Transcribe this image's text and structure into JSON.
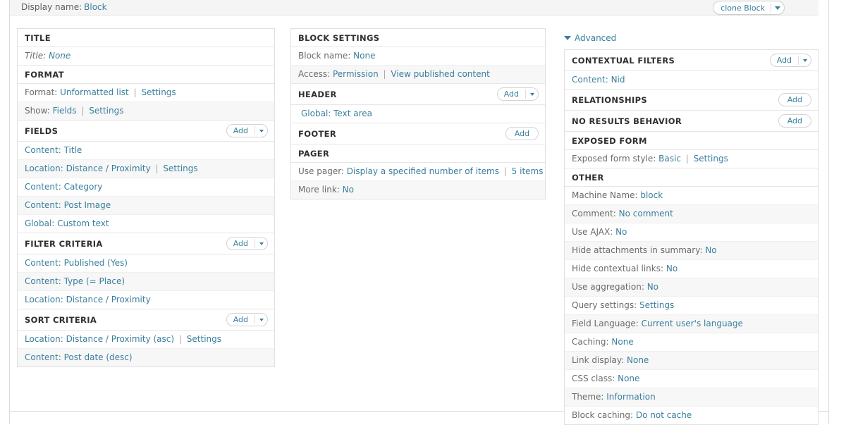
{
  "display_bar": {
    "label": "Display name:",
    "value": "Block",
    "clone_button": {
      "label": "clone Block",
      "caret_icon": "chevron-down-icon"
    }
  },
  "buttons": {
    "add": "Add"
  },
  "left_column": {
    "sections": [
      {
        "title": "TITLE",
        "has_add": false,
        "rows": [
          {
            "label": "Title:",
            "parts": [
              {
                "text": "None",
                "type": "link"
              }
            ],
            "italic": true
          }
        ]
      },
      {
        "title": "FORMAT",
        "has_add": false,
        "rows": [
          {
            "label": "Format:",
            "parts": [
              {
                "text": "Unformatted list",
                "type": "link"
              },
              {
                "text": "|",
                "type": "sep"
              },
              {
                "text": "Settings",
                "type": "link"
              }
            ]
          },
          {
            "label": "Show:",
            "parts": [
              {
                "text": "Fields",
                "type": "link"
              },
              {
                "text": "|",
                "type": "sep"
              },
              {
                "text": "Settings",
                "type": "link"
              }
            ]
          }
        ]
      },
      {
        "title": "FIELDS",
        "has_add": true,
        "add_caret": true,
        "rows": [
          {
            "label": "",
            "parts": [
              {
                "text": "Content: Title",
                "type": "link"
              }
            ]
          },
          {
            "label": "",
            "parts": [
              {
                "text": "Location: Distance / Proximity",
                "type": "link"
              },
              {
                "text": "|",
                "type": "sep"
              },
              {
                "text": "Settings",
                "type": "link"
              }
            ]
          },
          {
            "label": "",
            "parts": [
              {
                "text": "Content: Category",
                "type": "link"
              }
            ]
          },
          {
            "label": "",
            "parts": [
              {
                "text": "Content: Post Image",
                "type": "link"
              }
            ]
          },
          {
            "label": "",
            "parts": [
              {
                "text": "Global: Custom text",
                "type": "link"
              }
            ]
          }
        ]
      },
      {
        "title": "FILTER CRITERIA",
        "has_add": true,
        "add_caret": true,
        "rows": [
          {
            "label": "",
            "parts": [
              {
                "text": "Content: Published (Yes)",
                "type": "link"
              }
            ]
          },
          {
            "label": "",
            "parts": [
              {
                "text": "Content: Type (= Place)",
                "type": "link"
              }
            ]
          },
          {
            "label": "",
            "parts": [
              {
                "text": "Location: Distance / Proximity",
                "type": "link"
              }
            ]
          }
        ]
      },
      {
        "title": "SORT CRITERIA",
        "has_add": true,
        "add_caret": true,
        "rows": [
          {
            "label": "",
            "parts": [
              {
                "text": "Location: Distance / Proximity (asc)",
                "type": "link"
              },
              {
                "text": "|",
                "type": "sep"
              },
              {
                "text": "Settings",
                "type": "link"
              }
            ]
          },
          {
            "label": "",
            "parts": [
              {
                "text": "Content: Post date (desc)",
                "type": "link"
              }
            ]
          }
        ]
      }
    ]
  },
  "middle_column": {
    "sections": [
      {
        "title": "BLOCK SETTINGS",
        "has_add": false,
        "rows": [
          {
            "label": "Block name:",
            "parts": [
              {
                "text": "None",
                "type": "link"
              }
            ]
          },
          {
            "label": "Access:",
            "parts": [
              {
                "text": "Permission",
                "type": "link"
              },
              {
                "text": "|",
                "type": "sep"
              },
              {
                "text": "View published content",
                "type": "link"
              }
            ]
          }
        ]
      },
      {
        "title": "HEADER",
        "has_add": true,
        "add_caret": true,
        "rows": [
          {
            "label": "",
            "parts": [
              {
                "text": "Global: Text area",
                "type": "link"
              }
            ],
            "indent": true
          }
        ]
      },
      {
        "title": "FOOTER",
        "has_add": true,
        "add_caret": false,
        "rows": []
      },
      {
        "title": "PAGER",
        "has_add": false,
        "rows": [
          {
            "label": "Use pager:",
            "parts": [
              {
                "text": "Display a specified number of items",
                "type": "link"
              },
              {
                "text": "|",
                "type": "sep"
              },
              {
                "text": "5 items",
                "type": "link"
              }
            ]
          },
          {
            "label": "More link:",
            "parts": [
              {
                "text": "No",
                "type": "link"
              }
            ]
          }
        ]
      }
    ]
  },
  "right_column": {
    "advanced": {
      "label": "Advanced",
      "triangle_icon": "triangle-down-icon",
      "expanded": true
    },
    "sections": [
      {
        "title": "CONTEXTUAL FILTERS",
        "has_add": true,
        "add_caret": true,
        "rows": [
          {
            "label": "",
            "parts": [
              {
                "text": "Content: Nid",
                "type": "link"
              }
            ]
          }
        ]
      },
      {
        "title": "RELATIONSHIPS",
        "has_add": true,
        "add_caret": false,
        "rows": []
      },
      {
        "title": "NO RESULTS BEHAVIOR",
        "has_add": true,
        "add_caret": false,
        "rows": []
      },
      {
        "title": "EXPOSED FORM",
        "has_add": false,
        "rows": [
          {
            "label": "Exposed form style:",
            "parts": [
              {
                "text": "Basic",
                "type": "link"
              },
              {
                "text": "|",
                "type": "sep"
              },
              {
                "text": "Settings",
                "type": "link"
              }
            ]
          }
        ]
      },
      {
        "title": "OTHER",
        "has_add": false,
        "rows": [
          {
            "label": "Machine Name:",
            "parts": [
              {
                "text": "block",
                "type": "link"
              }
            ]
          },
          {
            "label": "Comment:",
            "parts": [
              {
                "text": "No comment",
                "type": "link"
              }
            ]
          },
          {
            "label": "Use AJAX:",
            "parts": [
              {
                "text": "No",
                "type": "link"
              }
            ]
          },
          {
            "label": "Hide attachments in summary:",
            "parts": [
              {
                "text": "No",
                "type": "link"
              }
            ]
          },
          {
            "label": "Hide contextual links:",
            "parts": [
              {
                "text": "No",
                "type": "link"
              }
            ]
          },
          {
            "label": "Use aggregation:",
            "parts": [
              {
                "text": "No",
                "type": "link"
              }
            ]
          },
          {
            "label": "Query settings:",
            "parts": [
              {
                "text": "Settings",
                "type": "link"
              }
            ]
          },
          {
            "label": "Field Language:",
            "parts": [
              {
                "text": "Current user's language",
                "type": "link"
              }
            ]
          },
          {
            "label": "Caching:",
            "parts": [
              {
                "text": "None",
                "type": "link"
              }
            ]
          },
          {
            "label": "Link display:",
            "parts": [
              {
                "text": "None",
                "type": "link"
              }
            ]
          },
          {
            "label": "CSS class:",
            "parts": [
              {
                "text": "None",
                "type": "link"
              }
            ]
          },
          {
            "label": "Theme:",
            "parts": [
              {
                "text": "Information",
                "type": "link"
              }
            ]
          },
          {
            "label": "Block caching:",
            "parts": [
              {
                "text": "Do not cache",
                "type": "link"
              }
            ]
          }
        ]
      }
    ]
  },
  "colors": {
    "link": "#3a7f9d",
    "label": "#6a6a6a",
    "heading": "#2f2f2f",
    "row_alt_bg": "#f7f7f7",
    "border": "#e0e0e0",
    "bar_bg": "#f5f5f5"
  }
}
